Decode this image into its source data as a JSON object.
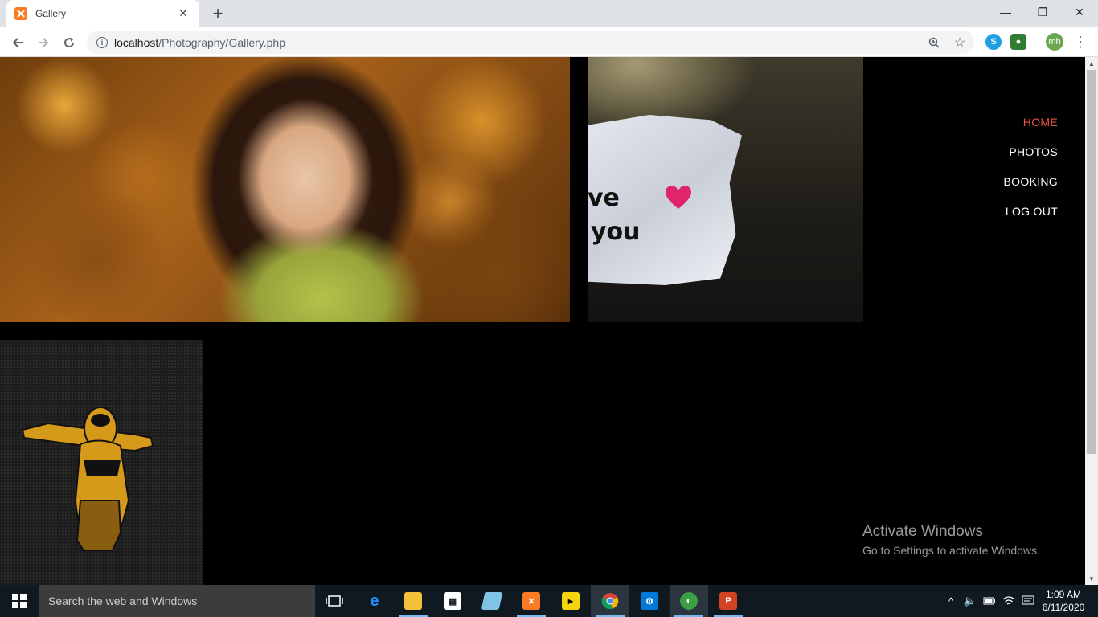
{
  "browser": {
    "tab_title": "Gallery",
    "tab_close": "✕",
    "new_tab": "+",
    "window_min": "—",
    "window_restore": "❐",
    "window_close": "✕",
    "url_host": "localhost",
    "url_path": "/Photography/Gallery.php",
    "profile_initials": "mh"
  },
  "page": {
    "nav": [
      {
        "label": "HOME",
        "active": true
      },
      {
        "label": "PHOTOS",
        "active": false
      },
      {
        "label": "BOOKING",
        "active": false
      },
      {
        "label": "LOG OUT",
        "active": false
      }
    ],
    "photo2_text_line1": "ve",
    "photo2_text_line2": "you"
  },
  "watermark": {
    "title": "Activate Windows",
    "subtitle": "Go to Settings to activate Windows."
  },
  "taskbar": {
    "search_placeholder": "Search the web and Windows",
    "time": "1:09 AM",
    "date": "6/11/2020",
    "icons": [
      "task-view-icon",
      "edge-icon",
      "file-explorer-icon",
      "store-icon",
      "app-icon",
      "xampp-icon",
      "player-icon",
      "chrome-icon",
      "settings-icon",
      "network-app-icon",
      "powerpoint-icon"
    ]
  },
  "colors": {
    "nav_active": "#e8553e",
    "nav_default": "#ffffff",
    "page_background": "#000000"
  }
}
